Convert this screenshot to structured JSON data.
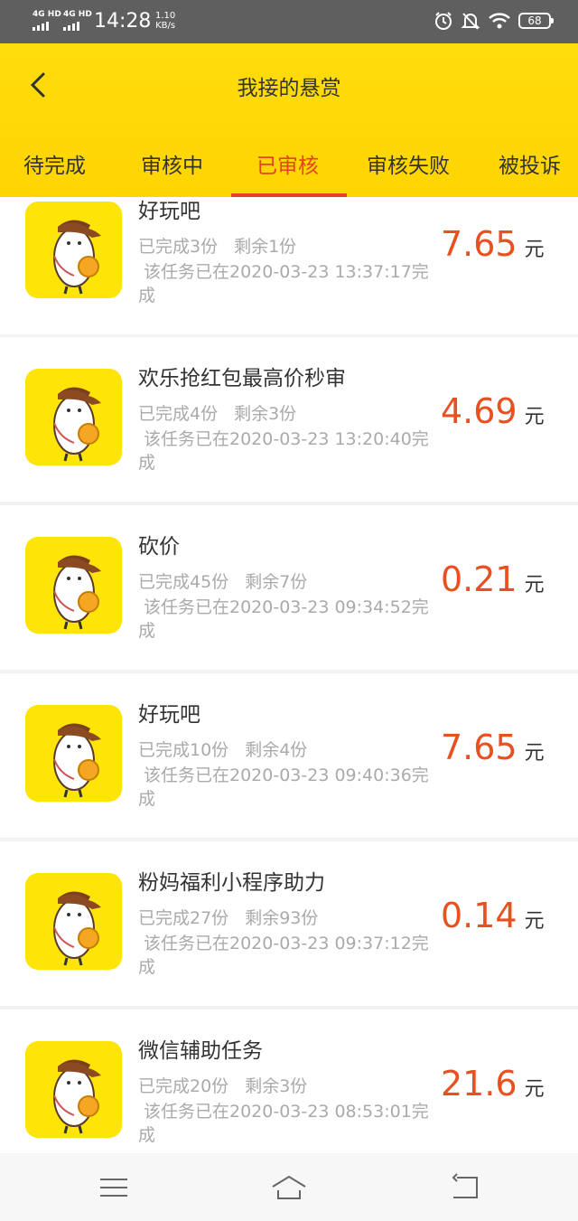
{
  "status_bar": {
    "network1": "4G HD",
    "network2": "4G HD",
    "time": "14:28",
    "speed_value": "1.10",
    "speed_unit": "KB/s",
    "icons": [
      "alarm-icon",
      "mute-bell-icon",
      "wifi-icon"
    ],
    "battery": "68"
  },
  "header": {
    "title": "我接的悬赏",
    "back_icon": "chevron-left-icon"
  },
  "tabs": [
    {
      "label": "待完成",
      "active": false
    },
    {
      "label": "审核中",
      "active": false
    },
    {
      "label": "已审核",
      "active": true
    },
    {
      "label": "审核失败",
      "active": false
    },
    {
      "label": "被投诉",
      "active": false
    }
  ],
  "tasks": [
    {
      "title": "好玩吧",
      "completed": "已完成3份",
      "remaining": "剩余1份",
      "time": "该任务已在2020-03-23 13:37:17完成",
      "price": "7.65",
      "unit": "元"
    },
    {
      "title": "欢乐抢红包最高价秒审",
      "completed": "已完成4份",
      "remaining": "剩余3份",
      "time": "该任务已在2020-03-23 13:20:40完成",
      "price": "4.69",
      "unit": "元"
    },
    {
      "title": "砍价",
      "completed": "已完成45份",
      "remaining": "剩余7份",
      "time": "该任务已在2020-03-23 09:34:52完成",
      "price": "0.21",
      "unit": "元"
    },
    {
      "title": "好玩吧",
      "completed": "已完成10份",
      "remaining": "剩余4份",
      "time": "该任务已在2020-03-23 09:40:36完成",
      "price": "7.65",
      "unit": "元"
    },
    {
      "title": "粉妈福利小程序助力",
      "completed": "已完成27份",
      "remaining": "剩余93份",
      "time": "该任务已在2020-03-23 09:37:12完成",
      "price": "0.14",
      "unit": "元"
    },
    {
      "title": "微信辅助任务",
      "completed": "已完成20份",
      "remaining": "剩余3份",
      "time": "该任务已在2020-03-23 08:53:01完成",
      "price": "21.6",
      "unit": "元"
    }
  ],
  "nav": {
    "icons": [
      "menu-icon",
      "home-icon",
      "back-icon"
    ]
  },
  "colors": {
    "header_yellow": "#ffd500",
    "accent_red": "#e8421c",
    "price_orange": "#e8501f",
    "thumb_yellow": "#ffe407"
  }
}
